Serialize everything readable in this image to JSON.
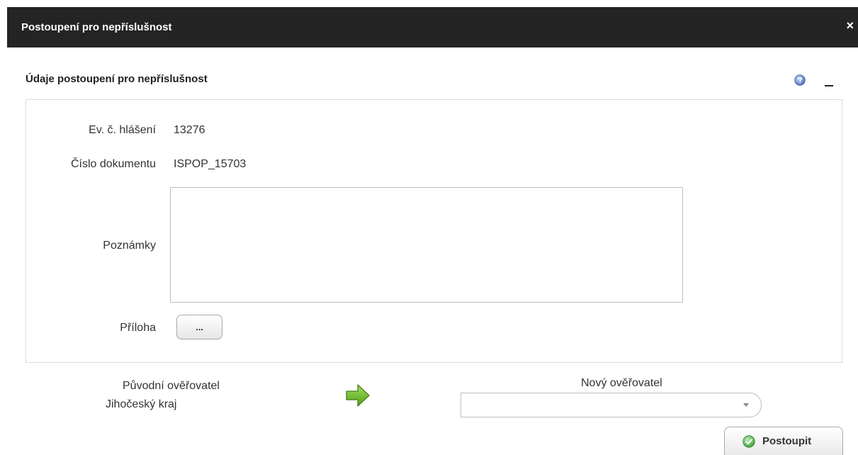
{
  "dialog": {
    "title": "Postoupení pro nepříslušnost",
    "close_label": "×"
  },
  "section": {
    "title": "Údaje postoupení pro nepříslušnost",
    "help_icon": "help-icon",
    "collapse_icon": "collapse-icon"
  },
  "form": {
    "report_number_label": "Ev. č. hlášení",
    "report_number_value": "13276",
    "document_number_label": "Číslo dokumentu",
    "document_number_value": "ISPOP_15703",
    "notes_label": "Poznámky",
    "notes_value": "",
    "attachment_label": "Příloha",
    "attachment_button_label": "..."
  },
  "transfer": {
    "original_verifier_label": "Původní ověřovatel",
    "original_verifier_value": "Jihočeský kraj",
    "arrow_icon": "arrow-right-icon",
    "new_verifier_label": "Nový ověřovatel",
    "new_verifier_selected": ""
  },
  "actions": {
    "submit_label": "Postoupit",
    "submit_icon": "check-circle-icon"
  },
  "colors": {
    "titlebar_bg": "#242424",
    "arrow_green": "#6cbb2b",
    "check_green": "#4caf50",
    "help_blue": "#5b7fc4"
  }
}
